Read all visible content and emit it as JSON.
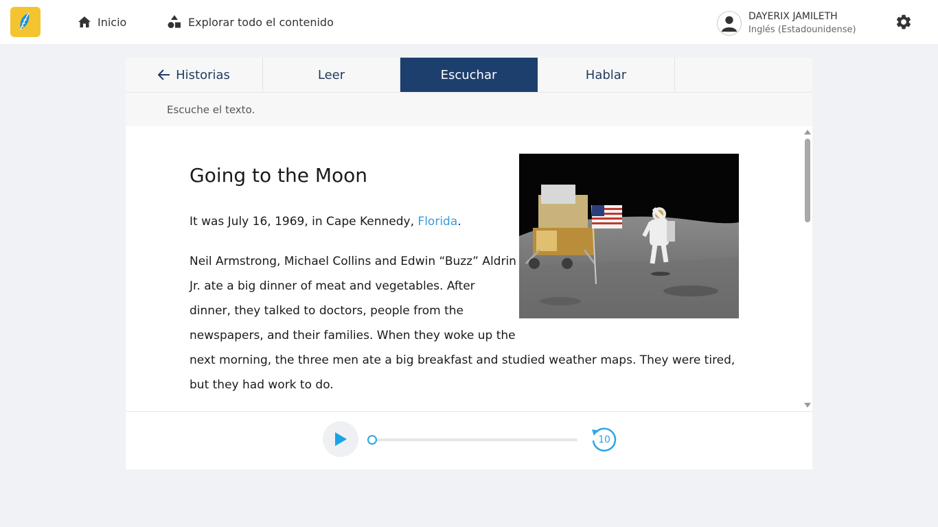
{
  "nav": {
    "home_label": "Inicio",
    "explore_label": "Explorar todo el contenido"
  },
  "user": {
    "name": "DAYERIX JAMILETH",
    "language": "Inglés (Estadounidense)"
  },
  "tabs": [
    {
      "label": "Historias",
      "icon": "arrow-left-icon"
    },
    {
      "label": "Leer"
    },
    {
      "label": "Escuchar",
      "active": true
    },
    {
      "label": "Hablar"
    }
  ],
  "instruction": "Escuche el texto.",
  "story": {
    "title": "Going to the Moon",
    "p1_before": "It was July 16, 1969, in Cape Kennedy, ",
    "p1_link": "Florida",
    "p1_after": ".",
    "p2_lines": [
      "Neil Armstrong, Michael Collins and Edwin “Buzz” Aldrin",
      " Jr. ate a big dinner of meat and vegetables. After",
      "dinner, they talked to doctors, people from the",
      "newspapers, and their families. When they woke up the",
      " next morning, the three men ate a big breakfast and studied weather maps. They were tired,",
      "but they had work to do."
    ]
  },
  "player": {
    "progress": 0,
    "rewind_seconds": "10"
  },
  "colors": {
    "accent": "#2aa6e0",
    "active_tab": "#1d3f6e",
    "logo": "#f4c430",
    "link": "#3b9ad9"
  }
}
